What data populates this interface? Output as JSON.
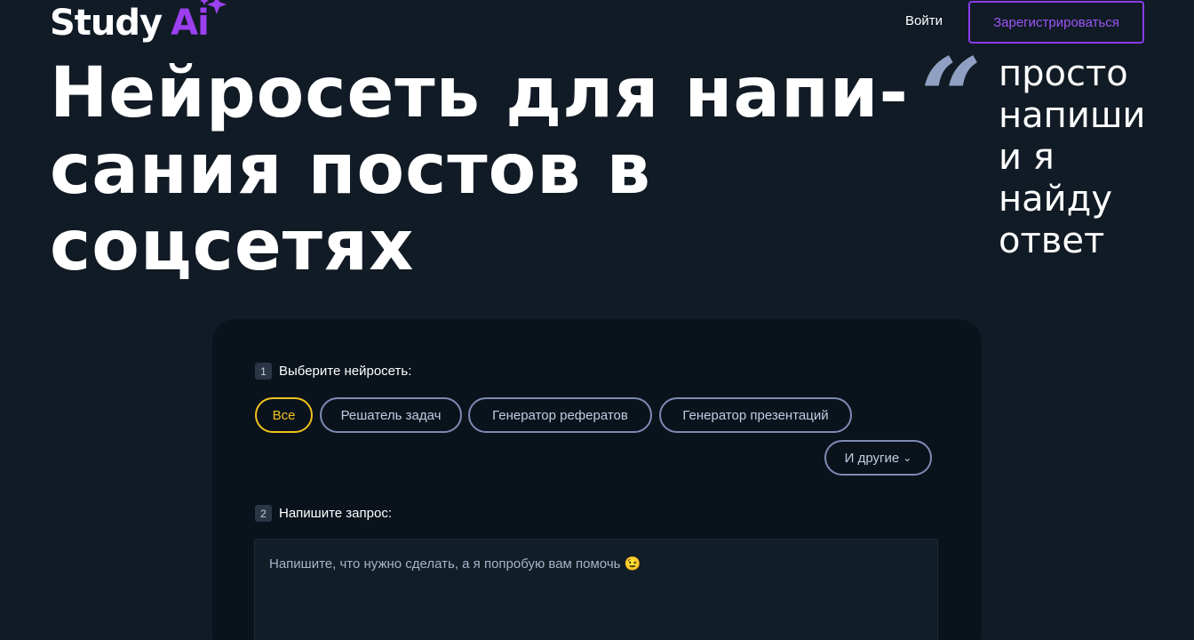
{
  "header": {
    "logo_study": "Study",
    "logo_ai": "Ai",
    "login_label": "Войти",
    "register_label": "Зарегистрироваться"
  },
  "hero": {
    "title_lines": [
      "Нейросеть для напи-",
      "сания постов в",
      "соцсетях"
    ],
    "quote_mark": "“",
    "tagline_lines": [
      "просто",
      "напиши",
      "и я",
      "найду",
      "ответ"
    ]
  },
  "card": {
    "step1": {
      "number": "1",
      "label": "Выберите нейросеть:"
    },
    "chips": [
      {
        "label": "Все",
        "active": true
      },
      {
        "label": "Решатель задач",
        "active": false
      },
      {
        "label": "Генератор рефератов",
        "active": false
      },
      {
        "label": "Генератор презентаций",
        "active": false
      }
    ],
    "more_label": "И другие",
    "step2": {
      "number": "2",
      "label": "Напишите запрос:"
    },
    "request_placeholder": "Напишите, что нужно сделать, а я попробую вам помочь 😉"
  },
  "colors": {
    "background": "#111b25",
    "accent_purple": "#8b3bea",
    "active_yellow": "#f2c21b"
  }
}
